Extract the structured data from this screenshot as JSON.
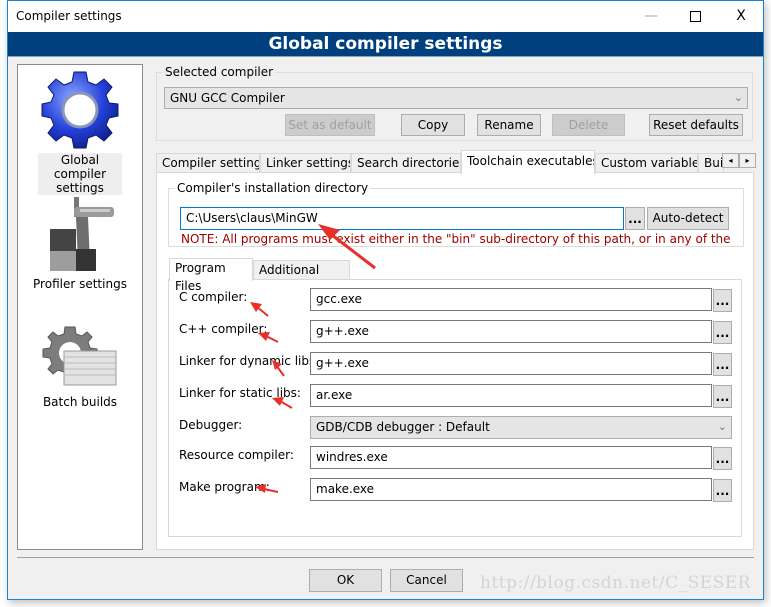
{
  "window": {
    "title": "Compiler settings",
    "minimize_icon": "minimize-icon",
    "maximize_icon": "maximize-icon",
    "close_label": "X"
  },
  "header": {
    "title": "Global compiler settings"
  },
  "sidebar": {
    "items": [
      {
        "label": "Global compiler settings",
        "icon": "gear-blue-icon",
        "active": true
      },
      {
        "label": "Profiler settings",
        "icon": "caliper-icon",
        "active": false
      },
      {
        "label": "Batch builds",
        "icon": "gear-stack-icon",
        "active": false
      }
    ]
  },
  "selected_compiler": {
    "legend": "Selected compiler",
    "value": "GNU GCC Compiler",
    "buttons": {
      "set_default": "Set as default",
      "copy": "Copy",
      "rename": "Rename",
      "delete": "Delete",
      "reset": "Reset defaults"
    }
  },
  "tabs": [
    {
      "label": "Compiler settings"
    },
    {
      "label": "Linker settings"
    },
    {
      "label": "Search directories"
    },
    {
      "label": "Toolchain executables",
      "active": true
    },
    {
      "label": "Custom variables"
    },
    {
      "label": "Build options"
    }
  ],
  "tab_scroll": {
    "left": "◂",
    "right": "▸"
  },
  "install_dir": {
    "legend": "Compiler's installation directory",
    "value": "C:\\Users\\claus\\MinGW",
    "browse": "...",
    "autodetect": "Auto-detect",
    "note": "NOTE: All programs must exist either in the \"bin\" sub-directory of this path, or in any of the"
  },
  "subtabs": [
    {
      "label": "Program Files",
      "active": true
    },
    {
      "label": "Additional Paths"
    }
  ],
  "programs": [
    {
      "label": "C compiler:",
      "value": "gcc.exe"
    },
    {
      "label": "C++ compiler:",
      "value": "g++.exe"
    },
    {
      "label": "Linker for dynamic libs:",
      "value": "g++.exe"
    },
    {
      "label": "Linker for static libs:",
      "value": "ar.exe"
    },
    {
      "label": "Debugger:",
      "value": "GDB/CDB debugger : Default",
      "type": "select"
    },
    {
      "label": "Resource compiler:",
      "value": "windres.exe"
    },
    {
      "label": "Make program:",
      "value": "make.exe"
    }
  ],
  "browse_label": "...",
  "footer": {
    "ok": "OK",
    "cancel": "Cancel"
  },
  "watermark": "http://blog.csdn.net/C_SESER",
  "colors": {
    "header_band": "#00407f",
    "note": "#a00000",
    "annotation_arrow": "#e8302a",
    "focus": "#0078d7"
  }
}
